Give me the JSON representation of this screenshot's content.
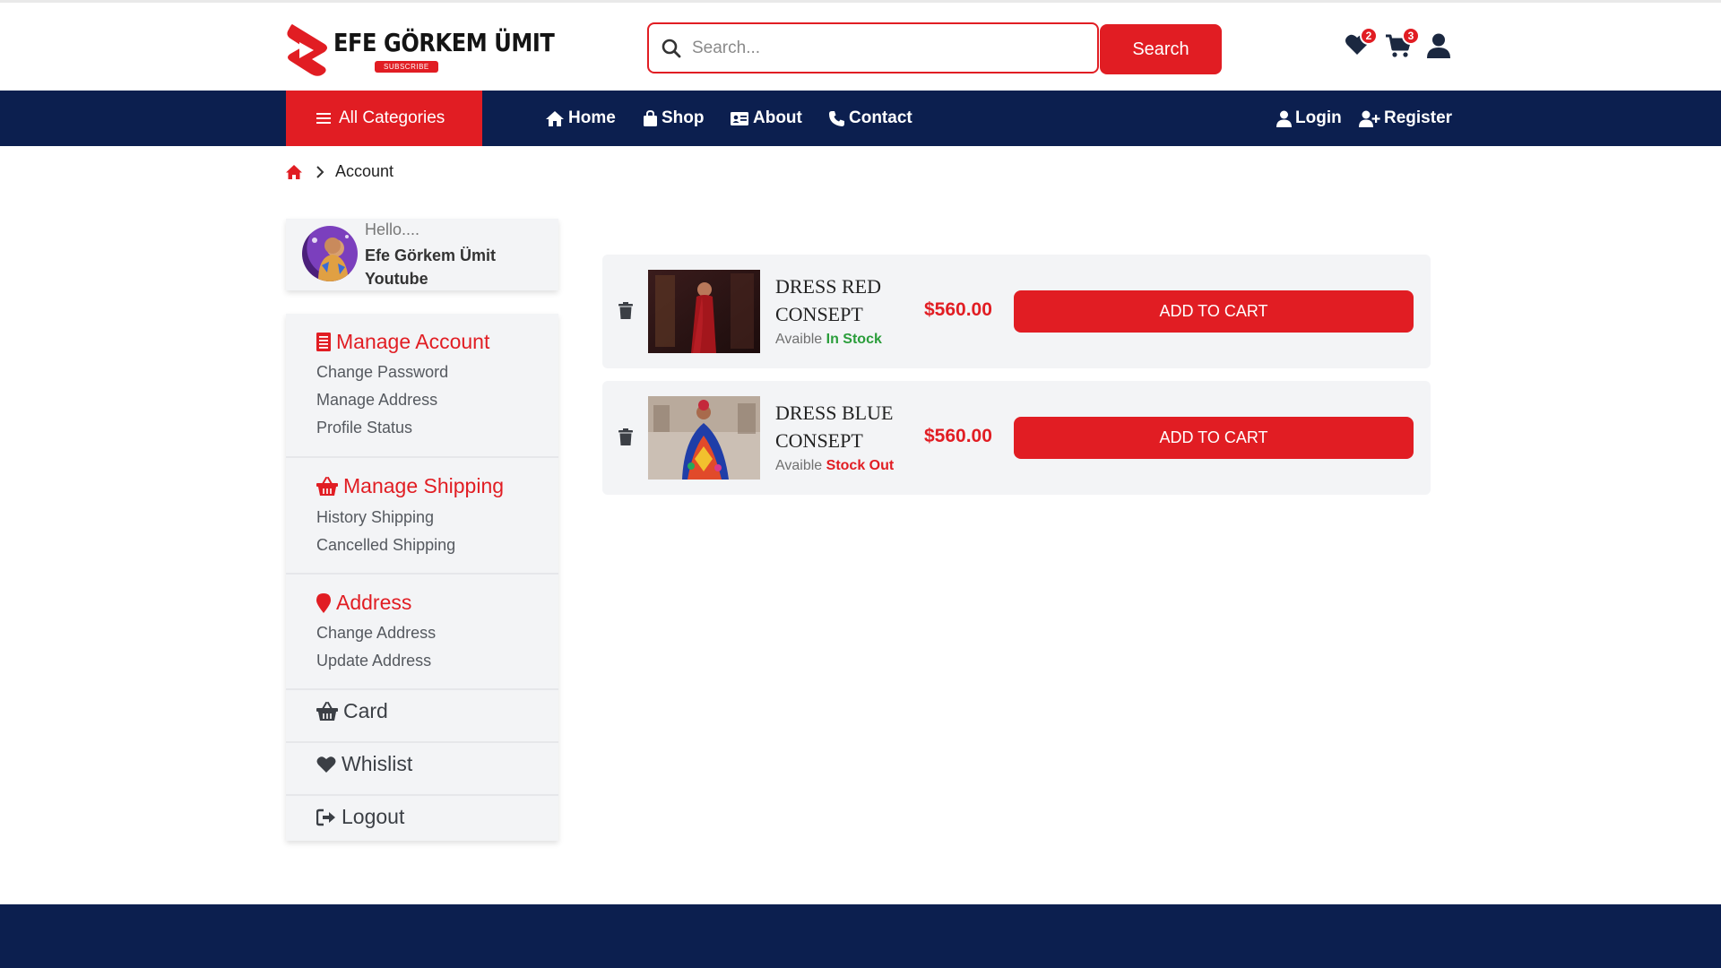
{
  "brand": {
    "name": "EFE GÖRKEM ÜMIT",
    "subscribe_label": "SUBSCRIBE",
    "accent_color": "#e11d23",
    "navy_color": "#0c1f4f"
  },
  "search": {
    "placeholder": "Search...",
    "button_label": "Search"
  },
  "header_icons": {
    "wishlist_count": "2",
    "cart_count": "3"
  },
  "nav": {
    "all_categories": "All Categories",
    "links": [
      {
        "label": "Home",
        "icon": "home-icon"
      },
      {
        "label": "Shop",
        "icon": "bag-icon"
      },
      {
        "label": "About",
        "icon": "id-card-icon"
      },
      {
        "label": "Contact",
        "icon": "phone-icon"
      }
    ],
    "login": "Login",
    "register": "Register"
  },
  "breadcrumb": {
    "current": "Account"
  },
  "profile": {
    "greeting": "Hello....",
    "name": "Efe Görkem Ümit Youtube"
  },
  "account_menu": {
    "manage_account": {
      "title": "Manage Account",
      "items": [
        "Change Password",
        "Manage Address",
        "Profile Status"
      ]
    },
    "manage_shipping": {
      "title": "Manage Shipping",
      "items": [
        "History Shipping",
        "Cancelled Shipping"
      ]
    },
    "address": {
      "title": "Address",
      "items": [
        "Change Address",
        "Update Address"
      ]
    },
    "card": "Card",
    "whislist": "Whislist",
    "logout": "Logout"
  },
  "wishlist_items": [
    {
      "name": "DRESS RED CONSEPT",
      "availability_label": "Avaible",
      "availability_status": "In Stock",
      "status_color": "#2a9d3a",
      "price": "$560.00",
      "button_label": "ADD TO CART"
    },
    {
      "name": "DRESS BLUE CONSEPT",
      "availability_label": "Avaible",
      "availability_status": "Stock Out",
      "status_color": "#e11d23",
      "price": "$560.00",
      "button_label": "ADD TO CART"
    }
  ]
}
